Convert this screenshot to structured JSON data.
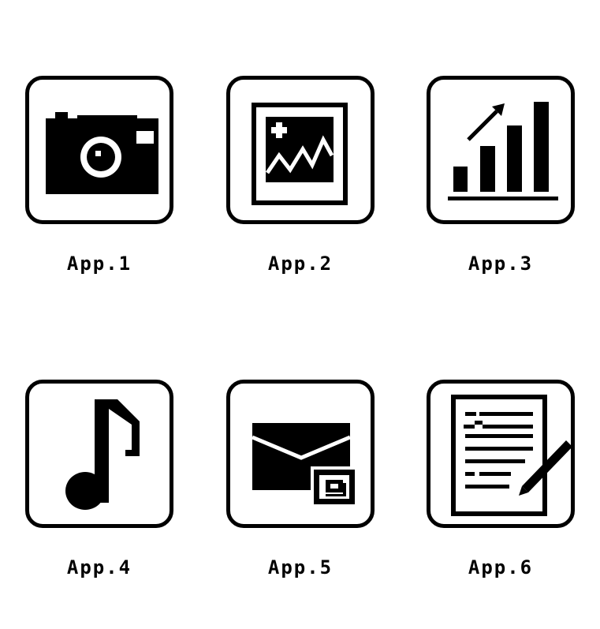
{
  "apps": [
    {
      "label": "App.1",
      "icon": "camera-icon"
    },
    {
      "label": "App.2",
      "icon": "picture-icon"
    },
    {
      "label": "App.3",
      "icon": "bar-chart-icon"
    },
    {
      "label": "App.4",
      "icon": "music-note-icon"
    },
    {
      "label": "App.5",
      "icon": "mail-icon"
    },
    {
      "label": "App.6",
      "icon": "document-edit-icon"
    }
  ],
  "colors": {
    "ink": "#000000",
    "background": "#ffffff"
  }
}
